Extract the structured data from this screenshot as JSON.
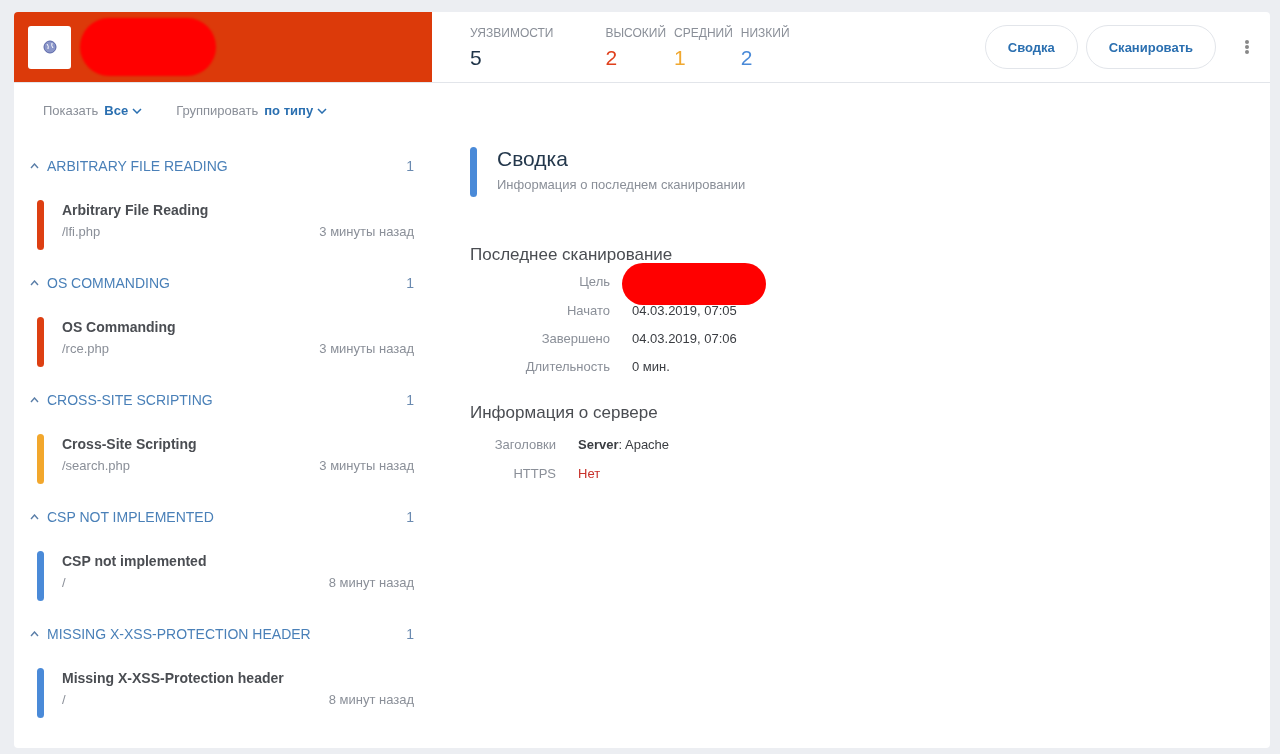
{
  "header": {
    "stats": [
      {
        "label": "УЯЗВИМОСТИ",
        "value": "5",
        "color": "#1f3448"
      },
      {
        "label": "ВЫСОКИЙ",
        "value": "2",
        "color": "#e0401c"
      },
      {
        "label": "СРЕДНИЙ",
        "value": "1",
        "color": "#f0a830"
      },
      {
        "label": "НИЗКИЙ",
        "value": "2",
        "color": "#4a8ad8"
      }
    ],
    "buttons": [
      "Сводка",
      "Сканировать"
    ]
  },
  "filters": [
    {
      "label": "Показать",
      "value": "Все"
    },
    {
      "label": "Группировать",
      "value": "по типу"
    }
  ],
  "groups": [
    {
      "title": "ARBITRARY FILE READING",
      "count": "1",
      "expanded": true,
      "items": [
        {
          "name": "Arbitrary File Reading",
          "path": "/lfi.php",
          "time": "3 минуты назад",
          "color": "#dd3f12"
        }
      ]
    },
    {
      "title": "OS COMMANDING",
      "count": "1",
      "expanded": true,
      "items": [
        {
          "name": "OS Commanding",
          "path": "/rce.php",
          "time": "3 минуты назад",
          "color": "#dd3f12"
        }
      ]
    },
    {
      "title": "CROSS-SITE SCRIPTING",
      "count": "1",
      "expanded": true,
      "items": [
        {
          "name": "Cross-Site Scripting",
          "path": "/search.php",
          "time": "3 минуты назад",
          "color": "#f2a72c"
        }
      ]
    },
    {
      "title": "CSP NOT IMPLEMENTED",
      "count": "1",
      "expanded": true,
      "items": [
        {
          "name": "CSP not implemented",
          "path": "/",
          "time": "8 минут назад",
          "color": "#4a8ad8"
        }
      ]
    },
    {
      "title": "MISSING X-XSS-PROTECTION HEADER",
      "count": "1",
      "expanded": true,
      "items": [
        {
          "name": "Missing X-XSS-Protection header",
          "path": "/",
          "time": "8 минут назад",
          "color": "#4a8ad8"
        }
      ]
    }
  ],
  "summary": {
    "title": "Сводка",
    "subtitle": "Информация о последнем сканировании",
    "last_scan": {
      "title": "Последнее сканирование",
      "rows": [
        {
          "label": "Цель",
          "value": ""
        },
        {
          "label": "Начато",
          "value": "04.03.2019, 07:05"
        },
        {
          "label": "Завершено",
          "value": "04.03.2019, 07:06"
        },
        {
          "label": "Длительность",
          "value": "0 мин."
        }
      ]
    },
    "server": {
      "title": "Информация о сервере",
      "rows": [
        {
          "label": "Заголовки",
          "value": "**Server**: Apache",
          "kind": "plain"
        },
        {
          "label": "HTTPS",
          "value": "Нет",
          "kind": "negative"
        }
      ]
    }
  }
}
